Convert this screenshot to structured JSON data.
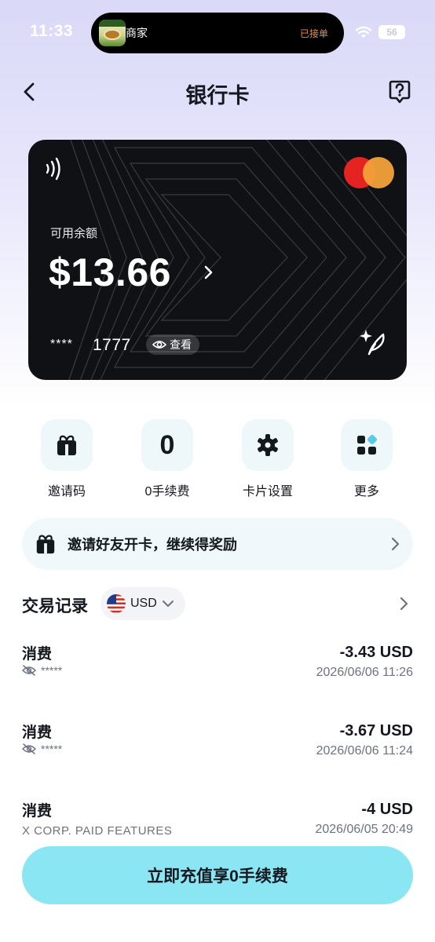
{
  "status_bar": {
    "time": "11:33",
    "island": {
      "merchant_label": "商家",
      "status": "已接单"
    },
    "battery": "56"
  },
  "header": {
    "title": "银行卡",
    "back_icon": "chevron-left-icon",
    "help_icon": "question-bubble-icon"
  },
  "card": {
    "balance_label": "可用余额",
    "balance": "$13.66",
    "masked_prefix": "****",
    "last4": "1777",
    "view_label": "查看",
    "brand": "mastercard",
    "brand_colors": [
      "#e52421",
      "#f4a23a"
    ]
  },
  "actions": [
    {
      "label": "邀请码",
      "icon": "gift-box-icon"
    },
    {
      "label": "0手续费",
      "icon": "zero-fee-icon",
      "glyph": "0"
    },
    {
      "label": "卡片设置",
      "icon": "gear-icon"
    },
    {
      "label": "更多",
      "icon": "grid-more-icon"
    }
  ],
  "invite_banner": {
    "text": "邀请好友开卡，继续得奖励"
  },
  "transactions": {
    "title": "交易记录",
    "currency": "USD",
    "items": [
      {
        "type": "消费",
        "description": "*****",
        "hidden": true,
        "amount": "-3.43 USD",
        "time": "2026/06/06 11:26"
      },
      {
        "type": "消费",
        "description": "*****",
        "hidden": true,
        "amount": "-3.67 USD",
        "time": "2026/06/06 11:24"
      },
      {
        "type": "消费",
        "description": "X CORP. PAID FEATURES",
        "hidden": false,
        "amount": "-4 USD",
        "time": "2026/06/05 20:49"
      }
    ]
  },
  "cta": {
    "label": "立即充值享0手续费"
  },
  "colors": {
    "accent": "#8ae6f3",
    "card_bg": "#101114",
    "tile_bg": "#eef8fb",
    "highlight": "#58c9e6"
  }
}
